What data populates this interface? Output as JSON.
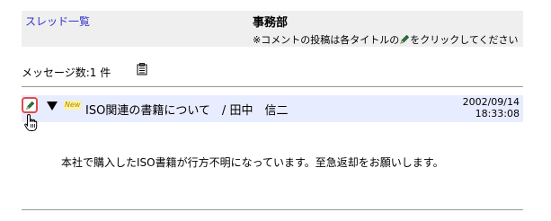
{
  "header": {
    "thread_list_link": "スレッド一覧",
    "department": "事務部",
    "instruction_before": "※コメントの投稿は各タイトルの",
    "instruction_after": "をクリックしてください"
  },
  "messages": {
    "count_label": "メッセージ数:1 件"
  },
  "thread": {
    "badge": "New",
    "title": "ISO関連の書籍について　/ 田中　信二",
    "date": "2002/09/14",
    "time": "18:33:08",
    "body": "本社で購入したISO書籍が行方不明になっています。至急返却をお願いします。"
  },
  "icons": {
    "edit": "pencil-icon",
    "expand": "triangle-down-icon",
    "clipboard": "clipboard-icon",
    "cursor": "hand-pointer-icon"
  },
  "colors": {
    "link": "#3333cc",
    "header_bg": "#efefef",
    "thread_bg": "#e8ecff",
    "edit_border": "#e24b4b"
  }
}
